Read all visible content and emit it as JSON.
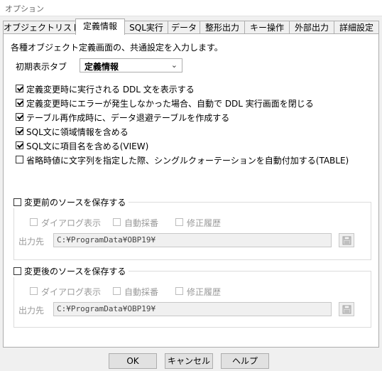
{
  "window": {
    "title": "オプション"
  },
  "tabs": [
    {
      "label": "オブジェクトリスト"
    },
    {
      "label": "定義情報"
    },
    {
      "label": "SQL実行"
    },
    {
      "label": "データ"
    },
    {
      "label": "整形出力"
    },
    {
      "label": "キー操作"
    },
    {
      "label": "外部出力"
    },
    {
      "label": "詳細設定"
    }
  ],
  "panel": {
    "description": "各種オブジェクト定義画面の、共通設定を入力します。",
    "initial_tab_label": "初期表示タブ",
    "initial_tab_value": "定義情報",
    "options": [
      {
        "label": "定義変更時に実行される DDL 文を表示する",
        "checked": true
      },
      {
        "label": "定義変更時にエラーが発生しなかった場合、自動で DDL 実行画面を閉じる",
        "checked": true
      },
      {
        "label": "テーブル再作成時に、データ退避テーブルを作成する",
        "checked": true
      },
      {
        "label": "SQL文に領域情報を含める",
        "checked": true
      },
      {
        "label": "SQL文に項目名を含める(VIEW)",
        "checked": true
      },
      {
        "label": "省略時値に文字列を指定した際、シングルクォーテーションを自動付加する(TABLE)",
        "checked": false
      }
    ],
    "before_group": {
      "title": "変更前のソースを保存する",
      "dialog_label": "ダイアログ表示",
      "autonum_label": "自動採番",
      "history_label": "修正履歴",
      "output_label": "出力先",
      "path": "C:¥ProgramData¥OBP19¥"
    },
    "after_group": {
      "title": "変更後のソースを保存する",
      "dialog_label": "ダイアログ表示",
      "autonum_label": "自動採番",
      "history_label": "修正履歴",
      "output_label": "出力先",
      "path": "C:¥ProgramData¥OBP19¥"
    }
  },
  "buttons": {
    "ok": "OK",
    "cancel": "キャンセル",
    "help": "ヘルプ"
  }
}
